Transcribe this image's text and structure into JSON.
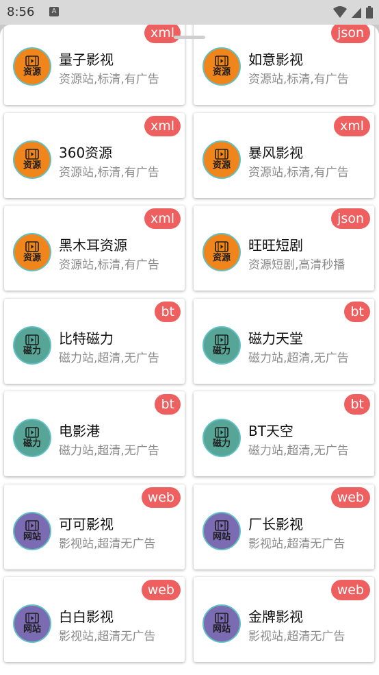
{
  "status": {
    "time": "8:56",
    "notif": "A"
  },
  "colors": {
    "orange": "#f0861b",
    "teal": "#57a596",
    "purple": "#7b6bb2",
    "badge": "#ee5f5f"
  },
  "cards": [
    {
      "title": "量子影视",
      "desc": "资源站,标清,有广告",
      "badge": "xml",
      "label": "资源",
      "type": "orange"
    },
    {
      "title": "如意影视",
      "desc": "资源站,标清,有广告",
      "badge": "json",
      "label": "资源",
      "type": "orange"
    },
    {
      "title": "360资源",
      "desc": "资源站,标清,有广告",
      "badge": "xml",
      "label": "资源",
      "type": "orange"
    },
    {
      "title": "暴风影视",
      "desc": "资源站,标清,有广告",
      "badge": "xml",
      "label": "资源",
      "type": "orange"
    },
    {
      "title": "黑木耳资源",
      "desc": "资源站,标清,有广告",
      "badge": "xml",
      "label": "资源",
      "type": "orange"
    },
    {
      "title": "旺旺短剧",
      "desc": "资源短剧,高清秒播",
      "badge": "json",
      "label": "资源",
      "type": "orange"
    },
    {
      "title": "比特磁力",
      "desc": "磁力站,超清,无广告",
      "badge": "bt",
      "label": "磁力",
      "type": "teal"
    },
    {
      "title": "磁力天堂",
      "desc": "磁力站,超清,无广告",
      "badge": "bt",
      "label": "磁力",
      "type": "teal"
    },
    {
      "title": "电影港",
      "desc": "磁力站,超清,无广告",
      "badge": "bt",
      "label": "磁力",
      "type": "teal"
    },
    {
      "title": "BT天空",
      "desc": "磁力站,超清,无广告",
      "badge": "bt",
      "label": "磁力",
      "type": "teal"
    },
    {
      "title": "可可影视",
      "desc": "影视站,超清无广告",
      "badge": "web",
      "label": "网站",
      "type": "purple"
    },
    {
      "title": "厂长影视",
      "desc": "影视站,超清无广告",
      "badge": "web",
      "label": "网站",
      "type": "purple"
    },
    {
      "title": "白白影视",
      "desc": "影视站,超清无广告",
      "badge": "web",
      "label": "网站",
      "type": "purple"
    },
    {
      "title": "金牌影视",
      "desc": "影视站,超清无广告",
      "badge": "web",
      "label": "网站",
      "type": "purple"
    }
  ]
}
